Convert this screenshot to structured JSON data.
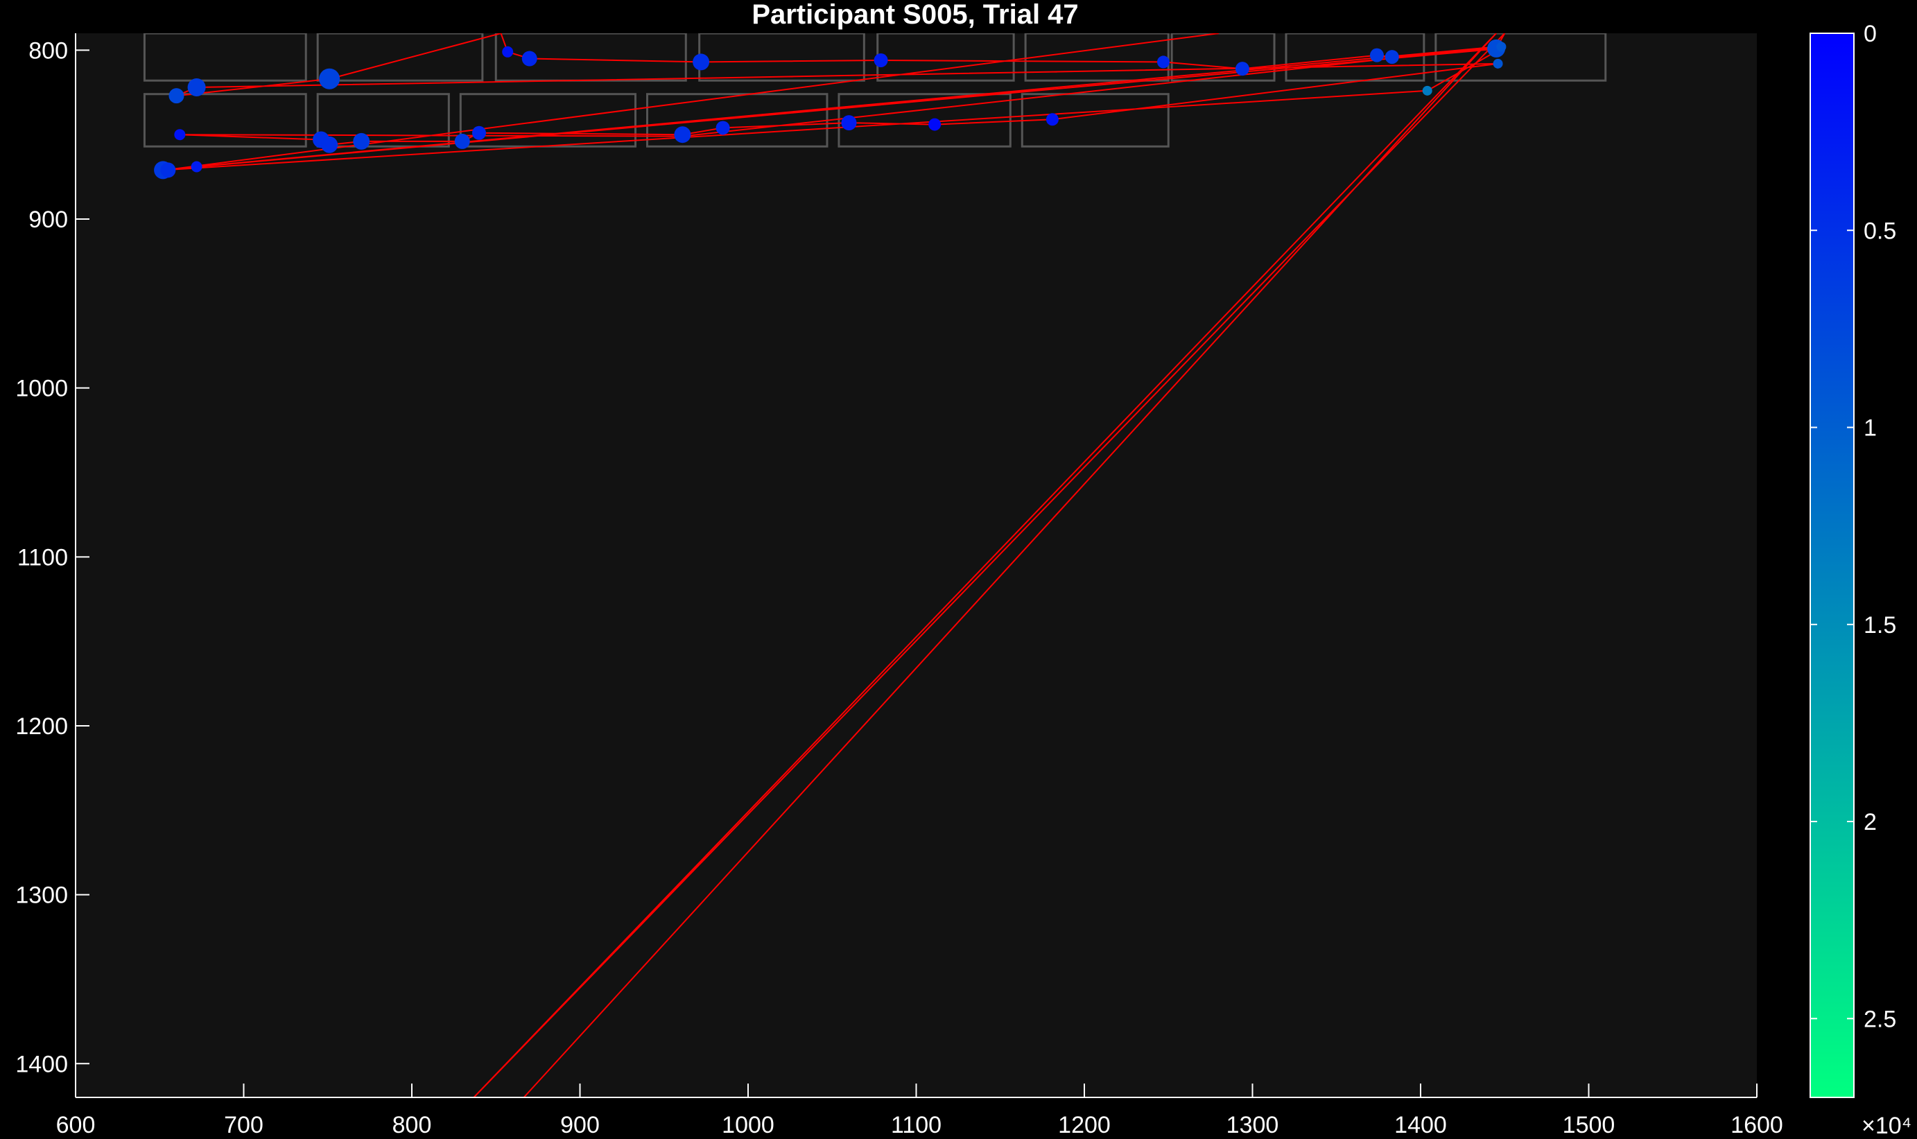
{
  "chart_data": {
    "type": "scatter",
    "title": "Participant S005, Trial 47",
    "xlabel": "",
    "ylabel": "",
    "xlim": [
      600,
      1600
    ],
    "ylim": [
      1420,
      790
    ],
    "y_reversed": true,
    "x_ticks": [
      600,
      700,
      800,
      900,
      1000,
      1100,
      1200,
      1300,
      1400,
      1500,
      1600
    ],
    "y_ticks": [
      800,
      900,
      1000,
      1100,
      1200,
      1300,
      1400
    ],
    "grid": false,
    "colors": {
      "background": "#121212",
      "path": "#ff0000",
      "box": "#555555",
      "axis": "#ffffff",
      "figure": "#000000"
    },
    "colorbar": {
      "min": 0,
      "max": 27000,
      "ticks": [
        0,
        5000,
        10000,
        15000,
        20000,
        25000
      ],
      "tick_labels": [
        "0",
        "0.5",
        "1",
        "1.5",
        "2",
        "2.5"
      ],
      "exponent_label": "×10⁴",
      "color_start": "#0000ff",
      "color_end": "#00ff80"
    },
    "region_boxes": [
      {
        "x0": 641,
        "x1": 737,
        "y0": 790,
        "y1": 818
      },
      {
        "x0": 744,
        "x1": 842,
        "y0": 790,
        "y1": 818
      },
      {
        "x0": 850,
        "x1": 963,
        "y0": 790,
        "y1": 818
      },
      {
        "x0": 971,
        "x1": 1069,
        "y0": 790,
        "y1": 818
      },
      {
        "x0": 1077,
        "x1": 1158,
        "y0": 790,
        "y1": 818
      },
      {
        "x0": 1165,
        "x1": 1250,
        "y0": 790,
        "y1": 818
      },
      {
        "x0": 1252,
        "x1": 1313,
        "y0": 790,
        "y1": 818
      },
      {
        "x0": 1320,
        "x1": 1402,
        "y0": 790,
        "y1": 818
      },
      {
        "x0": 1409,
        "x1": 1510,
        "y0": 790,
        "y1": 818
      },
      {
        "x0": 641,
        "x1": 737,
        "y0": 826,
        "y1": 857
      },
      {
        "x0": 744,
        "x1": 822,
        "y0": 826,
        "y1": 857
      },
      {
        "x0": 829,
        "x1": 933,
        "y0": 826,
        "y1": 857
      },
      {
        "x0": 940,
        "x1": 1047,
        "y0": 826,
        "y1": 857
      },
      {
        "x0": 1054,
        "x1": 1156,
        "y0": 826,
        "y1": 857
      },
      {
        "x0": 1163,
        "x1": 1250,
        "y0": 826,
        "y1": 857
      }
    ],
    "path": [
      {
        "x": 862,
        "y": 1425
      },
      {
        "x": 1445,
        "y": 790
      },
      {
        "x": 832,
        "y": 1425
      },
      {
        "x": 1450,
        "y": 790
      },
      {
        "x": 1445,
        "y": 799
      },
      {
        "x": 1383,
        "y": 804
      },
      {
        "x": 1374,
        "y": 803
      },
      {
        "x": 1294,
        "y": 811
      },
      {
        "x": 1247,
        "y": 807
      },
      {
        "x": 1079,
        "y": 806
      },
      {
        "x": 972,
        "y": 807
      },
      {
        "x": 870,
        "y": 805
      },
      {
        "x": 857,
        "y": 801
      },
      {
        "x": 853,
        "y": 790
      },
      {
        "x": 751,
        "y": 817
      },
      {
        "x": 660,
        "y": 827
      },
      {
        "x": 672,
        "y": 822
      },
      {
        "x": 1446,
        "y": 808
      },
      {
        "x": 1181,
        "y": 841
      },
      {
        "x": 1111,
        "y": 844
      },
      {
        "x": 1060,
        "y": 843
      },
      {
        "x": 985,
        "y": 846
      },
      {
        "x": 961,
        "y": 850
      },
      {
        "x": 840,
        "y": 849
      },
      {
        "x": 830,
        "y": 854
      },
      {
        "x": 770,
        "y": 854
      },
      {
        "x": 751,
        "y": 856
      },
      {
        "x": 746,
        "y": 853
      },
      {
        "x": 662,
        "y": 850
      },
      {
        "x": 961,
        "y": 851
      },
      {
        "x": 1445,
        "y": 798
      },
      {
        "x": 672,
        "y": 869
      },
      {
        "x": 652,
        "y": 871
      },
      {
        "x": 1404,
        "y": 824
      },
      {
        "x": 1448,
        "y": 799
      },
      {
        "x": 662,
        "y": 870
      },
      {
        "x": 653,
        "y": 871
      },
      {
        "x": 1280,
        "y": 790
      }
    ],
    "fixations": [
      {
        "x": 857,
        "y": 801,
        "t": 2000,
        "size": 8
      },
      {
        "x": 870,
        "y": 805,
        "t": 4000,
        "size": 11
      },
      {
        "x": 972,
        "y": 807,
        "t": 5000,
        "size": 12
      },
      {
        "x": 1079,
        "y": 806,
        "t": 3000,
        "size": 10
      },
      {
        "x": 1247,
        "y": 807,
        "t": 4000,
        "size": 9
      },
      {
        "x": 1294,
        "y": 811,
        "t": 5000,
        "size": 10
      },
      {
        "x": 1374,
        "y": 803,
        "t": 6000,
        "size": 10
      },
      {
        "x": 1383,
        "y": 804,
        "t": 6000,
        "size": 10
      },
      {
        "x": 1445,
        "y": 799,
        "t": 8000,
        "size": 13
      },
      {
        "x": 1448,
        "y": 798,
        "t": 9000,
        "size": 7
      },
      {
        "x": 1446,
        "y": 808,
        "t": 9000,
        "size": 7
      },
      {
        "x": 1404,
        "y": 824,
        "t": 13000,
        "size": 7
      },
      {
        "x": 751,
        "y": 817,
        "t": 7000,
        "size": 15
      },
      {
        "x": 660,
        "y": 827,
        "t": 7500,
        "size": 11
      },
      {
        "x": 672,
        "y": 822,
        "t": 6500,
        "size": 13
      },
      {
        "x": 662,
        "y": 850,
        "t": 2000,
        "size": 8
      },
      {
        "x": 746,
        "y": 853,
        "t": 5000,
        "size": 12
      },
      {
        "x": 751,
        "y": 856,
        "t": 5000,
        "size": 12
      },
      {
        "x": 770,
        "y": 854,
        "t": 6000,
        "size": 12
      },
      {
        "x": 830,
        "y": 854,
        "t": 6000,
        "size": 11
      },
      {
        "x": 840,
        "y": 849,
        "t": 4000,
        "size": 10
      },
      {
        "x": 961,
        "y": 850,
        "t": 5000,
        "size": 12
      },
      {
        "x": 985,
        "y": 846,
        "t": 4000,
        "size": 10
      },
      {
        "x": 1060,
        "y": 843,
        "t": 3000,
        "size": 11
      },
      {
        "x": 1111,
        "y": 844,
        "t": 1000,
        "size": 9
      },
      {
        "x": 1181,
        "y": 841,
        "t": 2000,
        "size": 9
      },
      {
        "x": 652,
        "y": 871,
        "t": 6000,
        "size": 13
      },
      {
        "x": 655,
        "y": 871,
        "t": 5000,
        "size": 11
      },
      {
        "x": 672,
        "y": 869,
        "t": 3000,
        "size": 8
      }
    ]
  }
}
